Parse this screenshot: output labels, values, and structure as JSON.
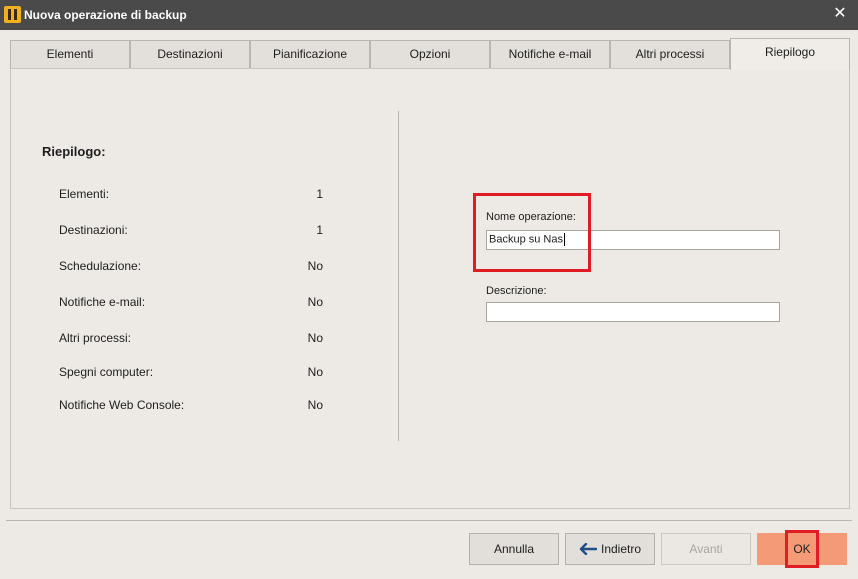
{
  "window": {
    "title": "Nuova operazione di backup",
    "app_icon": "app-logo-icon",
    "close_icon": "close-icon"
  },
  "tabs": [
    {
      "label": "Elementi"
    },
    {
      "label": "Destinazioni"
    },
    {
      "label": "Pianificazione"
    },
    {
      "label": "Opzioni"
    },
    {
      "label": "Notifiche e-mail"
    },
    {
      "label": "Altri processi"
    },
    {
      "label": "Riepilogo",
      "active": true
    }
  ],
  "summary": {
    "heading": "Riepilogo:",
    "rows": [
      {
        "label": "Elementi:",
        "value": "1"
      },
      {
        "label": "Destinazioni:",
        "value": "1"
      },
      {
        "label": "Schedulazione:",
        "value": "No"
      },
      {
        "label": "Notifiche e-mail:",
        "value": "No"
      },
      {
        "label": "Altri processi:",
        "value": "No"
      },
      {
        "label": "Spegni computer:",
        "value": "No"
      },
      {
        "label": "Notifiche Web Console:",
        "value": "No"
      }
    ]
  },
  "form": {
    "name_label": "Nome operazione:",
    "name_value": "Backup su Nas",
    "description_label": "Descrizione:",
    "description_value": ""
  },
  "buttons": {
    "cancel": "Annulla",
    "back": "Indietro",
    "next": "Avanti",
    "ok": "OK"
  },
  "colors": {
    "titlebar": "#4a4a4a",
    "ok_button": "#f59a76",
    "highlight": "#e01c25"
  }
}
